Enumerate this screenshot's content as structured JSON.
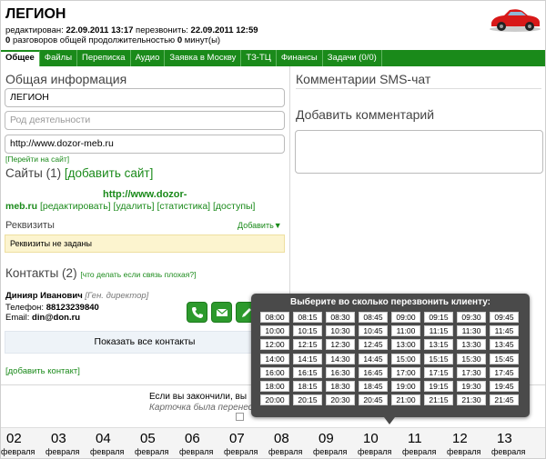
{
  "header": {
    "title": "ЛЕГИОН",
    "edited_label": "редактирован:",
    "edited_value": "22.09.2011 13:17",
    "callback_label": "перезвонить:",
    "callback_value": "22.09.2011 12:59",
    "calls_count": "0",
    "calls_text": "разговоров общей продолжительностью",
    "calls_minutes": "0",
    "calls_unit": "минут(ы)"
  },
  "tabs": [
    {
      "label": "Общее",
      "active": true
    },
    {
      "label": "Файлы"
    },
    {
      "label": "Переписка"
    },
    {
      "label": "Аудио"
    },
    {
      "label": "Заявка в Москву"
    },
    {
      "label": "ТЗ-ТЦ"
    },
    {
      "label": "Финансы"
    },
    {
      "label": "Задачи (0/0)"
    }
  ],
  "general": {
    "title": "Общая информация",
    "name_value": "ЛЕГИОН",
    "activity_placeholder": "Род деятельности",
    "site_value": "http://www.dozor-meb.ru",
    "goto_site": "[Перейти на сайт]"
  },
  "sites": {
    "title": "Сайты (1)",
    "add": "[добавить сайт]",
    "url_line1": "http://www.dozor-",
    "url_line2": "meb.ru",
    "edit": "[редактировать]",
    "delete": "[удалить]",
    "stats": "[статистика]",
    "access": "[доступы]"
  },
  "requisites": {
    "title": "Реквизиты",
    "add": "Добавить▼",
    "empty": "Реквизиты не заданы"
  },
  "contacts": {
    "title": "Контакты (2)",
    "hint": "[что делать если связь плохая?]",
    "name": "Динияр Иванович",
    "role": "[Ген. директор]",
    "phone_label": "Телефон:",
    "phone": "88123239840",
    "email_label": "Email:",
    "email": "din@don.ru",
    "show_all": "Показать все контакты",
    "add_contact": "[добавить контакт]"
  },
  "comments": {
    "title": "Комментарии SMS-чат",
    "add_title": "Добавить комментарий"
  },
  "finish": {
    "line1": "Если вы закончили, вы",
    "line2": "Карточка была перенесе"
  },
  "popup": {
    "title": "Выберите во сколько перезвонить клиенту:",
    "times": [
      "08:00",
      "08:15",
      "08:30",
      "08:45",
      "09:00",
      "09:15",
      "09:30",
      "09:45",
      "10:00",
      "10:15",
      "10:30",
      "10:45",
      "11:00",
      "11:15",
      "11:30",
      "11:45",
      "12:00",
      "12:15",
      "12:30",
      "12:45",
      "13:00",
      "13:15",
      "13:30",
      "13:45",
      "14:00",
      "14:15",
      "14:30",
      "14:45",
      "15:00",
      "15:15",
      "15:30",
      "15:45",
      "16:00",
      "16:15",
      "16:30",
      "16:45",
      "17:00",
      "17:15",
      "17:30",
      "17:45",
      "18:00",
      "18:15",
      "18:30",
      "18:45",
      "19:00",
      "19:15",
      "19:30",
      "19:45",
      "20:00",
      "20:15",
      "20:30",
      "20:45",
      "21:00",
      "21:15",
      "21:30",
      "21:45"
    ]
  },
  "dates": [
    {
      "day": "02",
      "month": "февраля"
    },
    {
      "day": "03",
      "month": "февраля"
    },
    {
      "day": "04",
      "month": "февраля"
    },
    {
      "day": "05",
      "month": "февраля"
    },
    {
      "day": "06",
      "month": "февраля"
    },
    {
      "day": "07",
      "month": "февраля"
    },
    {
      "day": "08",
      "month": "февраля"
    },
    {
      "day": "09",
      "month": "февраля"
    },
    {
      "day": "10",
      "month": "февраля"
    },
    {
      "day": "11",
      "month": "февраля"
    },
    {
      "day": "12",
      "month": "февраля"
    },
    {
      "day": "13",
      "month": "февраля"
    }
  ],
  "colors": {
    "brand_green": "#1a8a1a",
    "popup_bg": "#4a4a4a",
    "requisites_bg": "#fcf4cf"
  }
}
